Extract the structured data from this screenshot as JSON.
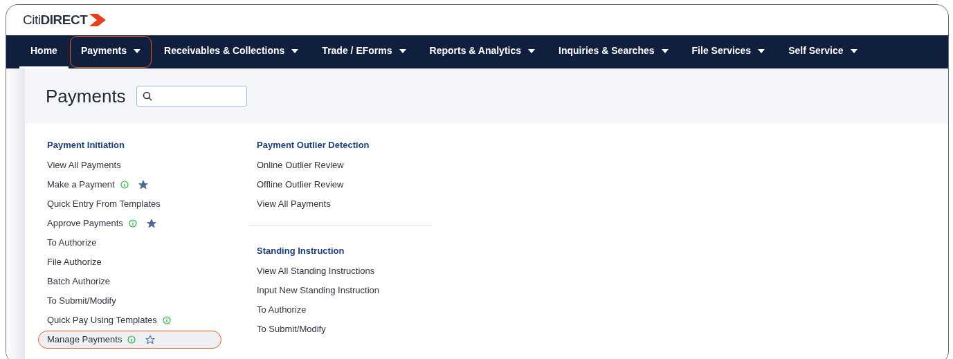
{
  "logo": {
    "text_light": "Citi",
    "text_bold": "DIRECT"
  },
  "nav": [
    {
      "label": "Home",
      "selected": true,
      "dropdown": false,
      "highlighted": false
    },
    {
      "label": "Payments",
      "selected": false,
      "dropdown": true,
      "highlighted": true
    },
    {
      "label": "Receivables & Collections",
      "selected": false,
      "dropdown": true,
      "highlighted": false
    },
    {
      "label": "Trade / EForms",
      "selected": false,
      "dropdown": true,
      "highlighted": false
    },
    {
      "label": "Reports & Analytics",
      "selected": false,
      "dropdown": true,
      "highlighted": false
    },
    {
      "label": "Inquiries & Searches",
      "selected": false,
      "dropdown": true,
      "highlighted": false
    },
    {
      "label": "File Services",
      "selected": false,
      "dropdown": true,
      "highlighted": false
    },
    {
      "label": "Self Service",
      "selected": false,
      "dropdown": true,
      "highlighted": false
    }
  ],
  "page_title": "Payments",
  "columns": [
    {
      "sections": [
        {
          "title": "Payment Initiation",
          "items": [
            {
              "label": "View All Payments",
              "info": false,
              "star": false,
              "highlighted": false
            },
            {
              "label": "Make a Payment",
              "info": true,
              "star": true,
              "starred": true,
              "highlighted": false
            },
            {
              "label": "Quick Entry From Templates",
              "info": false,
              "star": false,
              "highlighted": false
            },
            {
              "label": "Approve Payments",
              "info": true,
              "star": true,
              "starred": true,
              "highlighted": false
            },
            {
              "label": "To Authorize",
              "info": false,
              "star": false,
              "highlighted": false
            },
            {
              "label": "File Authorize",
              "info": false,
              "star": false,
              "highlighted": false
            },
            {
              "label": "Batch Authorize",
              "info": false,
              "star": false,
              "highlighted": false
            },
            {
              "label": "To Submit/Modify",
              "info": false,
              "star": false,
              "highlighted": false
            },
            {
              "label": "Quick Pay Using Templates",
              "info": true,
              "star": false,
              "highlighted": false
            },
            {
              "label": "Manage Payments",
              "info": true,
              "star": true,
              "starred": false,
              "highlighted": true
            }
          ]
        }
      ]
    },
    {
      "sections": [
        {
          "title": "Payment Outlier Detection",
          "items": [
            {
              "label": "Online Outlier Review",
              "info": false,
              "star": false,
              "highlighted": false
            },
            {
              "label": "Offline Outlier Review",
              "info": false,
              "star": false,
              "highlighted": false
            },
            {
              "label": "View All Payments",
              "info": false,
              "star": false,
              "highlighted": false
            }
          ]
        },
        {
          "title": "Standing Instruction",
          "items": [
            {
              "label": "View All Standing Instructions",
              "info": false,
              "star": false,
              "highlighted": false
            },
            {
              "label": "Input New Standing Instruction",
              "info": false,
              "star": false,
              "highlighted": false
            },
            {
              "label": "To Authorize",
              "info": false,
              "star": false,
              "highlighted": false
            },
            {
              "label": "To Submit/Modify",
              "info": false,
              "star": false,
              "highlighted": false
            }
          ]
        }
      ]
    }
  ]
}
